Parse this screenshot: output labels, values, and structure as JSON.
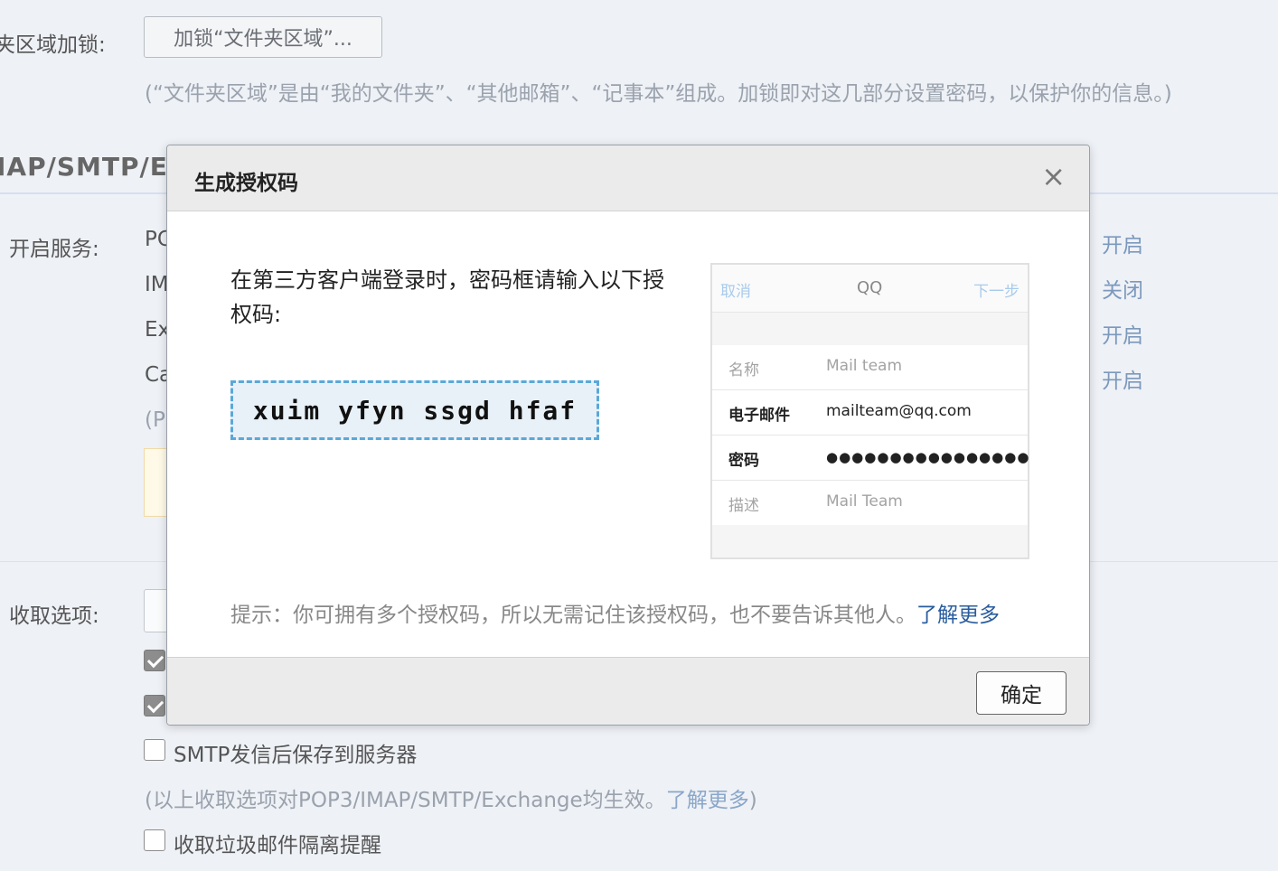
{
  "background": {
    "folder_lock": {
      "label": "夹区域加锁:",
      "button": "加锁“文件夹区域”...",
      "note": "(“文件夹区域”是由“我的文件夹”、“其他邮箱”、“记事本”组成。加锁即对这几部分设置密码，以保护你的信息。)"
    },
    "section_title": "IAP/SMTP/E",
    "services": {
      "label": "开启服务:",
      "items": [
        {
          "name": "PC",
          "toggle": "开启"
        },
        {
          "name": "IM",
          "toggle": "关闭"
        },
        {
          "name": "Ex",
          "toggle": "开启"
        },
        {
          "name": "Ca",
          "toggle": "开启"
        }
      ],
      "note_partial": "(P"
    },
    "fetch": {
      "label": "收取选项:",
      "options": [
        {
          "label": "SMTP发信后保存到服务器",
          "checked": false
        },
        {
          "label": "收取垃圾邮件隔离提醒",
          "checked": false
        }
      ],
      "note": "(以上收取选项对POP3/IMAP/SMTP/Exchange均生效。",
      "note_link": "了解更多",
      "note_end": ")"
    }
  },
  "modal": {
    "title": "生成授权码",
    "close_icon": "×",
    "intro": "在第三方客户端登录时，密码框请输入以下授权码:",
    "auth_code": "xuim yfyn ssgd hfaf",
    "phone_preview": {
      "cancel": "取消",
      "title": "QQ",
      "next": "下一步",
      "rows": [
        {
          "key": "名称",
          "value": "Mail team",
          "style": "dim"
        },
        {
          "key": "电子邮件",
          "value": "mailteam@qq.com",
          "style": "bold"
        },
        {
          "key": "密码",
          "value": "●●●●●●●●●●●●●●●●",
          "style": "bold"
        },
        {
          "key": "描述",
          "value": "Mail Team",
          "style": "dim"
        }
      ]
    },
    "tip": "提示：你可拥有多个授权码，所以无需记住该授权码，也不要告诉其他人。",
    "tip_link": "了解更多",
    "ok_button": "确定"
  },
  "colors": {
    "page_bg": "#eef1f6",
    "link_blue": "#2a5d9e",
    "toggle_blue": "#7c99bd",
    "code_border": "#5aa8d8"
  }
}
